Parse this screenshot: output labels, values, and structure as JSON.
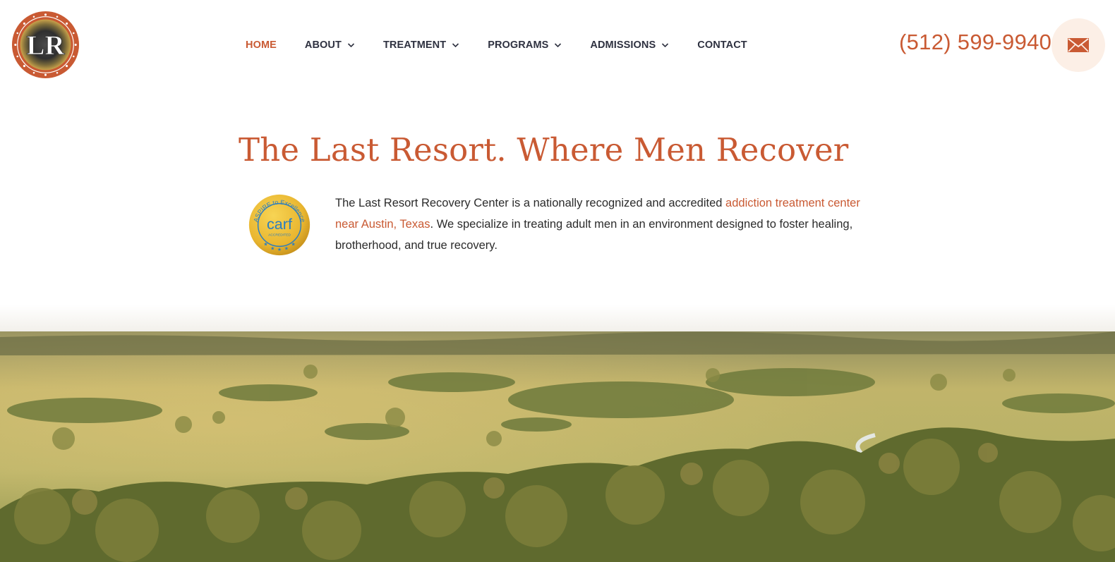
{
  "header": {
    "logo": {
      "text": "LR",
      "icon": "lr-monogram-logo"
    },
    "nav": [
      {
        "label": "HOME",
        "active": true,
        "dropdown": false
      },
      {
        "label": "ABOUT",
        "active": false,
        "dropdown": true
      },
      {
        "label": "TREATMENT",
        "active": false,
        "dropdown": true
      },
      {
        "label": "PROGRAMS",
        "active": false,
        "dropdown": true
      },
      {
        "label": "ADMISSIONS",
        "active": false,
        "dropdown": true
      },
      {
        "label": "CONTACT",
        "active": false,
        "dropdown": false
      }
    ],
    "phone": "(512) 599-9940",
    "mail_icon": "envelope-icon"
  },
  "intro": {
    "title": "The Last Resort. Where Men Recover",
    "badge": {
      "arc_text": "ASPIRE to Excellence",
      "name": "carf",
      "subtext": "ACCREDITED"
    },
    "text_before": "The Last Resort Recovery Center is a nationally recognized and accredited ",
    "link_text": "addiction treatment center near Austin, Texas",
    "text_after": ". We specialize in treating adult men in an environment designed to foster healing, brotherhood, and true recovery."
  },
  "colors": {
    "accent": "#c95a33",
    "nav_text": "#2e3140",
    "body_text": "#2b2b2b",
    "mail_bg": "#fcefe6",
    "badge_gold": "#e9b630",
    "badge_blue": "#2b7dc0"
  }
}
